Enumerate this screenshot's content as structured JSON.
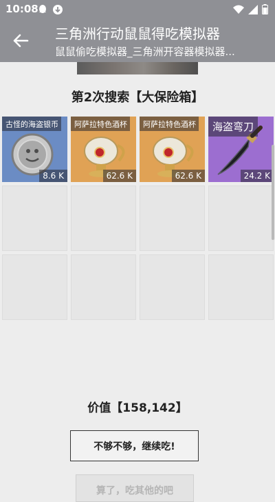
{
  "status_bar": {
    "time": "10:08",
    "icons_left": [
      "qq-icon",
      "download-icon"
    ],
    "icons_right": [
      "wifi-icon",
      "signal-icon",
      "battery-icon"
    ]
  },
  "app_bar": {
    "title": "三角洲行动鼠鼠得吃模拟器",
    "subtitle": "鼠鼠偷吃模拟器_三角洲开容器模拟器..."
  },
  "search": {
    "title": "第2次搜索【大保险箱】"
  },
  "items": [
    {
      "name": "古怪的海盗银币",
      "price": "8.6 K",
      "bg": "#6b8cc4",
      "art": "coin-icon"
    },
    {
      "name": "阿萨拉特色酒杯",
      "price": "62.6 K",
      "bg": "#e0a255",
      "art": "goblet-icon"
    },
    {
      "name": "阿萨拉特色酒杯",
      "price": "62.6 K",
      "bg": "#e0a255",
      "art": "goblet-icon"
    },
    {
      "name": "海盗弯刀",
      "price": "24.2 K",
      "bg": "#9c6ed0",
      "art": "scimitar-icon"
    }
  ],
  "empty_slots": 8,
  "total": {
    "value_text": "价值【158,142】"
  },
  "buttons": {
    "continue": "不够不够，继续吃!",
    "next": "算了，吃其他的吧"
  },
  "colors": {
    "appbar": "#8f9095",
    "background": "#ededed",
    "blue_item": "#6b8cc4",
    "gold_item": "#e0a255",
    "purple_item": "#9c6ed0"
  }
}
